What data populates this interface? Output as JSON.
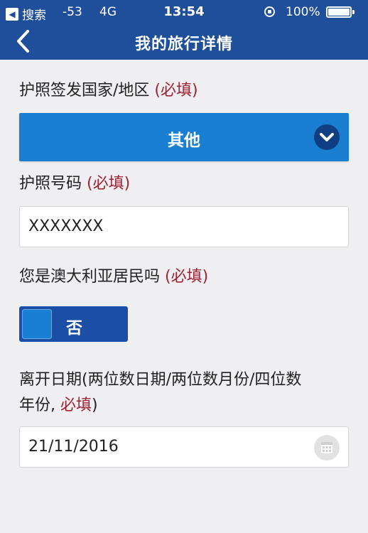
{
  "status_bar": {
    "back_app": "搜索",
    "signal": "-53",
    "network": "4G",
    "time": "13:54",
    "battery_pct": "100%",
    "battery_level": 1.0
  },
  "nav": {
    "title": "我的旅行详情"
  },
  "form": {
    "passport_country": {
      "label": "护照签发国家/地区",
      "required": "(必填)",
      "value": "其他"
    },
    "passport_number": {
      "label": "护照号码",
      "required": "(必填)",
      "value": "XXXXXXX"
    },
    "resident": {
      "label": "您是澳大利亚居民吗",
      "required": "(必填)",
      "value": "否"
    },
    "departure_date": {
      "label_line1": "离开日期(两位数日期/两位数月份/四位数",
      "label_line2": "年份, ",
      "required": "必填",
      "label_close": ")",
      "value": "21/11/2016"
    }
  },
  "colors": {
    "header": "#1f4f9a",
    "accent": "#1a7fd0",
    "required": "#9b2335"
  }
}
